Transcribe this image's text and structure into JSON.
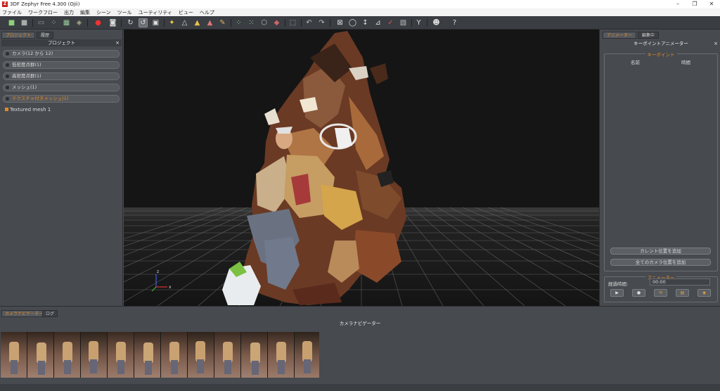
{
  "window": {
    "title": "3DF Zephyr Free 4.300 (Ojii)",
    "app_icon": "Z",
    "minimize": "–",
    "maximize": "❐",
    "close": "✕"
  },
  "menu": [
    "ファイル",
    "ワークフロー",
    "出力",
    "編集",
    "シーン",
    "ツール",
    "ユーティリティ",
    "ビュー",
    "ヘルプ"
  ],
  "left_panel": {
    "tabs": [
      "プロジェクト",
      "履歴"
    ],
    "title": "プロジェクト",
    "close": "×",
    "items": [
      {
        "label": "カメラ(12 から 12)"
      },
      {
        "label": "低密度点群(1)"
      },
      {
        "label": "高密度点群(1)"
      },
      {
        "label": "メッシュ(1)"
      },
      {
        "label": "テクスチャ付きメッシュ(1)"
      }
    ],
    "mesh_item": "Textured mesh 1"
  },
  "viewport": {
    "axis_z": "z",
    "axis_x": "x"
  },
  "right_panel": {
    "tabs": [
      "アニメーター",
      "編集中"
    ],
    "title": "キーポイントアニメーター",
    "close": "×",
    "keypoint_group": "キーポイント",
    "col_name": "名前",
    "col_time": "時間",
    "add_current_btn": "カレント位置を追加",
    "add_all_btn": "全てのカメラ位置を追加",
    "animator_group": "アニメーター",
    "duration_label": "経過時間:",
    "duration_value": "00:00",
    "playback_icons": [
      "▶",
      "●",
      "⟲",
      "▤",
      "◉"
    ]
  },
  "bottom_panel": {
    "tabs": [
      "カメラナビゲーター",
      "ログ"
    ],
    "title": "カメラナビゲーター"
  },
  "colors": {
    "accent": "#e08a2b",
    "panel": "#474a4f",
    "viewport_bg": "#151515"
  }
}
